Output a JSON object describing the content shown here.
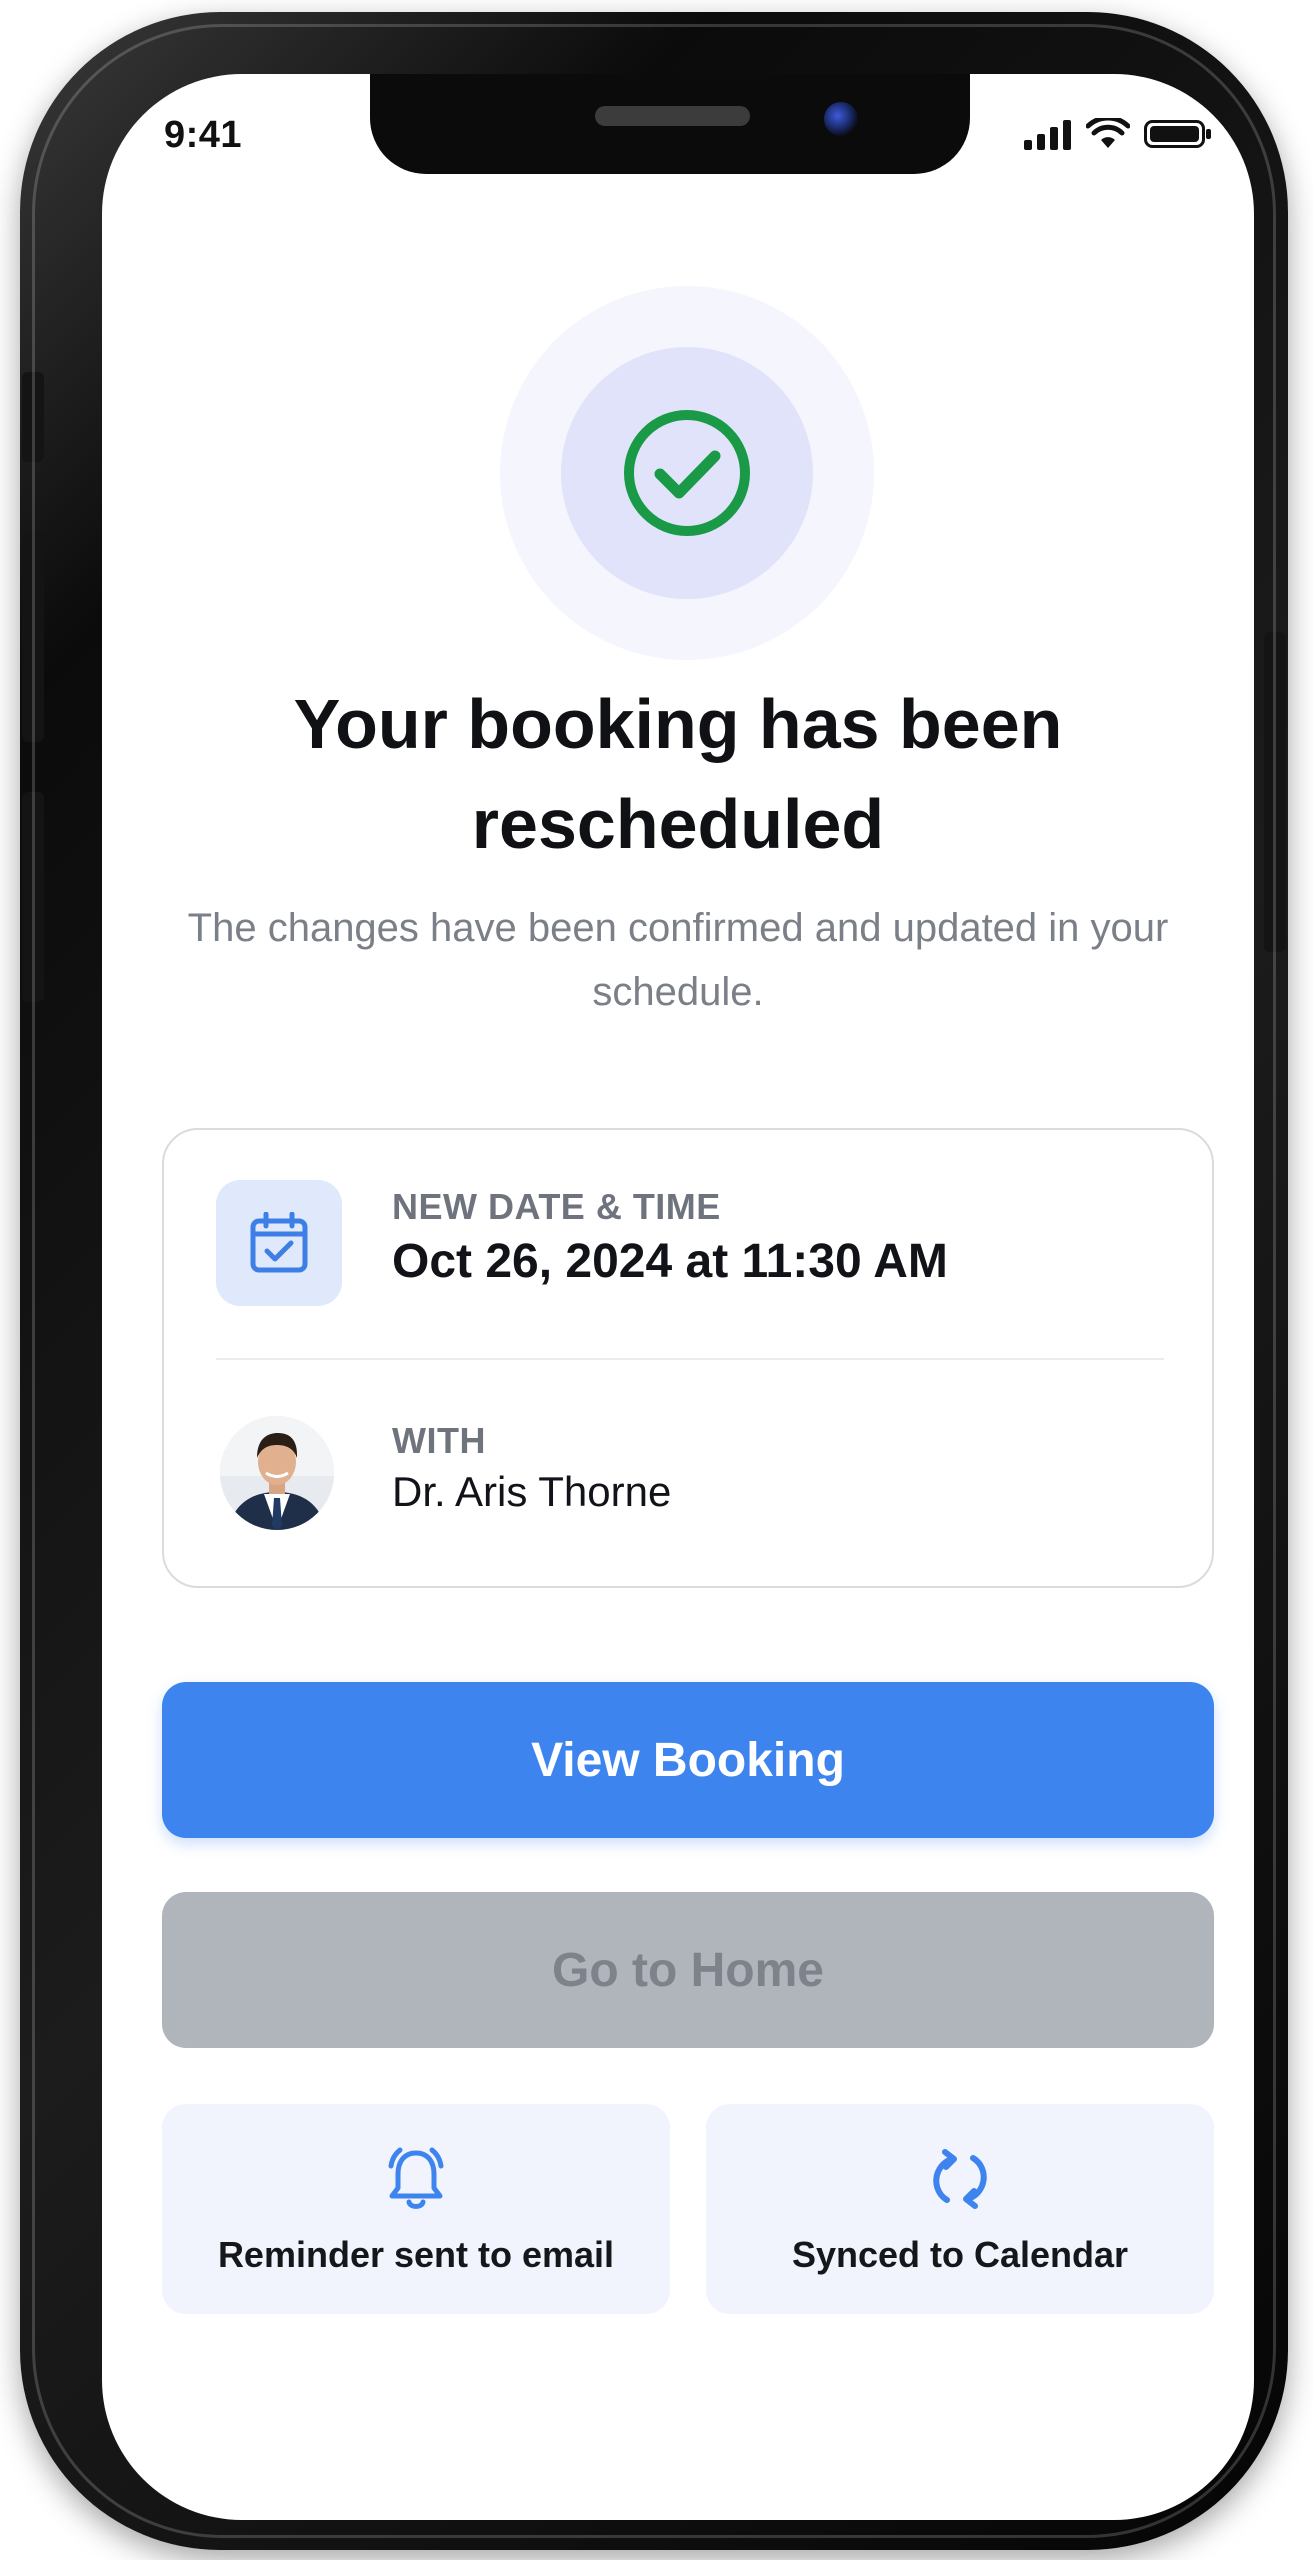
{
  "status_bar": {
    "time": "9:41",
    "icons": [
      "cellular-signal-icon",
      "wifi-icon",
      "battery-icon"
    ]
  },
  "hero": {
    "icon": "check-circle-icon",
    "title": "Your booking has been rescheduled",
    "subtitle": "The changes have been confirmed and updated in your schedule."
  },
  "details": {
    "date_time": {
      "icon": "calendar-check-icon",
      "label": "NEW DATE & TIME",
      "value": "Oct 26, 2024 at 11:30 AM"
    },
    "provider": {
      "label": "WITH",
      "name": "Dr. Aris Thorne"
    }
  },
  "actions": {
    "primary_label": "View Booking",
    "secondary_label": "Go to Home"
  },
  "info_tiles": [
    {
      "icon": "bell-icon",
      "label": "Reminder sent to email"
    },
    {
      "icon": "sync-icon",
      "label": "Synced to Calendar"
    }
  ],
  "colors": {
    "accent": "#3d84ef",
    "success": "#1a9a46",
    "disabled_bg": "#b0b4bb",
    "tile_bg": "#f1f3fd"
  }
}
